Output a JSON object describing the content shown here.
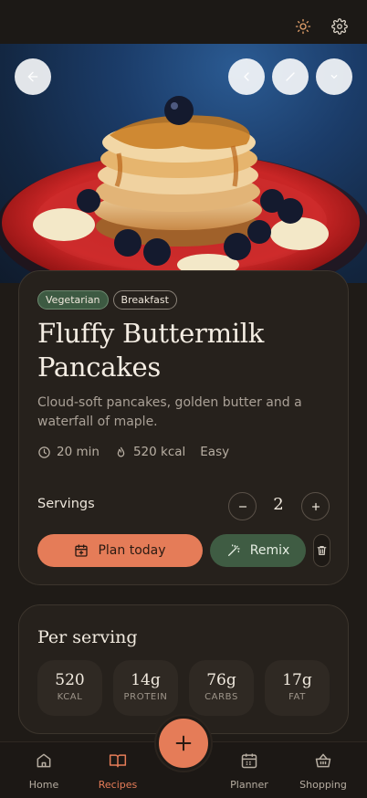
{
  "header": {
    "theme_icon": "sun-icon",
    "settings_icon": "gear-icon"
  },
  "hero": {
    "back_icon": "arrow-left-icon",
    "share_icon": "share-icon",
    "edit_icon": "pencil-icon",
    "favorite_icon": "heart-icon"
  },
  "recipe": {
    "tags": [
      "Vegetarian",
      "Breakfast"
    ],
    "title": "Fluffy Buttermilk Pancakes",
    "description": "Cloud-soft pancakes, golden butter and a waterfall of maple.",
    "time": "20 min",
    "calories": "520 kcal",
    "difficulty": "Easy",
    "servings_label": "Servings",
    "servings": "2",
    "plan_label": "Plan today",
    "remix_label": "Remix"
  },
  "nutrition": {
    "heading": "Per serving",
    "items": [
      {
        "value": "520",
        "label": "KCAL"
      },
      {
        "value": "14g",
        "label": "PROTEIN"
      },
      {
        "value": "76g",
        "label": "CARBS"
      },
      {
        "value": "17g",
        "label": "FAT"
      }
    ]
  },
  "nav": {
    "items": [
      {
        "label": "Home",
        "icon": "home-icon"
      },
      {
        "label": "Recipes",
        "icon": "book-icon"
      },
      {
        "label": "Planner",
        "icon": "calendar-icon"
      },
      {
        "label": "Shopping",
        "icon": "basket-icon"
      }
    ],
    "active": "Recipes",
    "add_icon": "plus-icon"
  },
  "colors": {
    "accent": "#e57c58",
    "green": "#3f5c43",
    "background": "#1f1b17",
    "card": "#26211c"
  }
}
